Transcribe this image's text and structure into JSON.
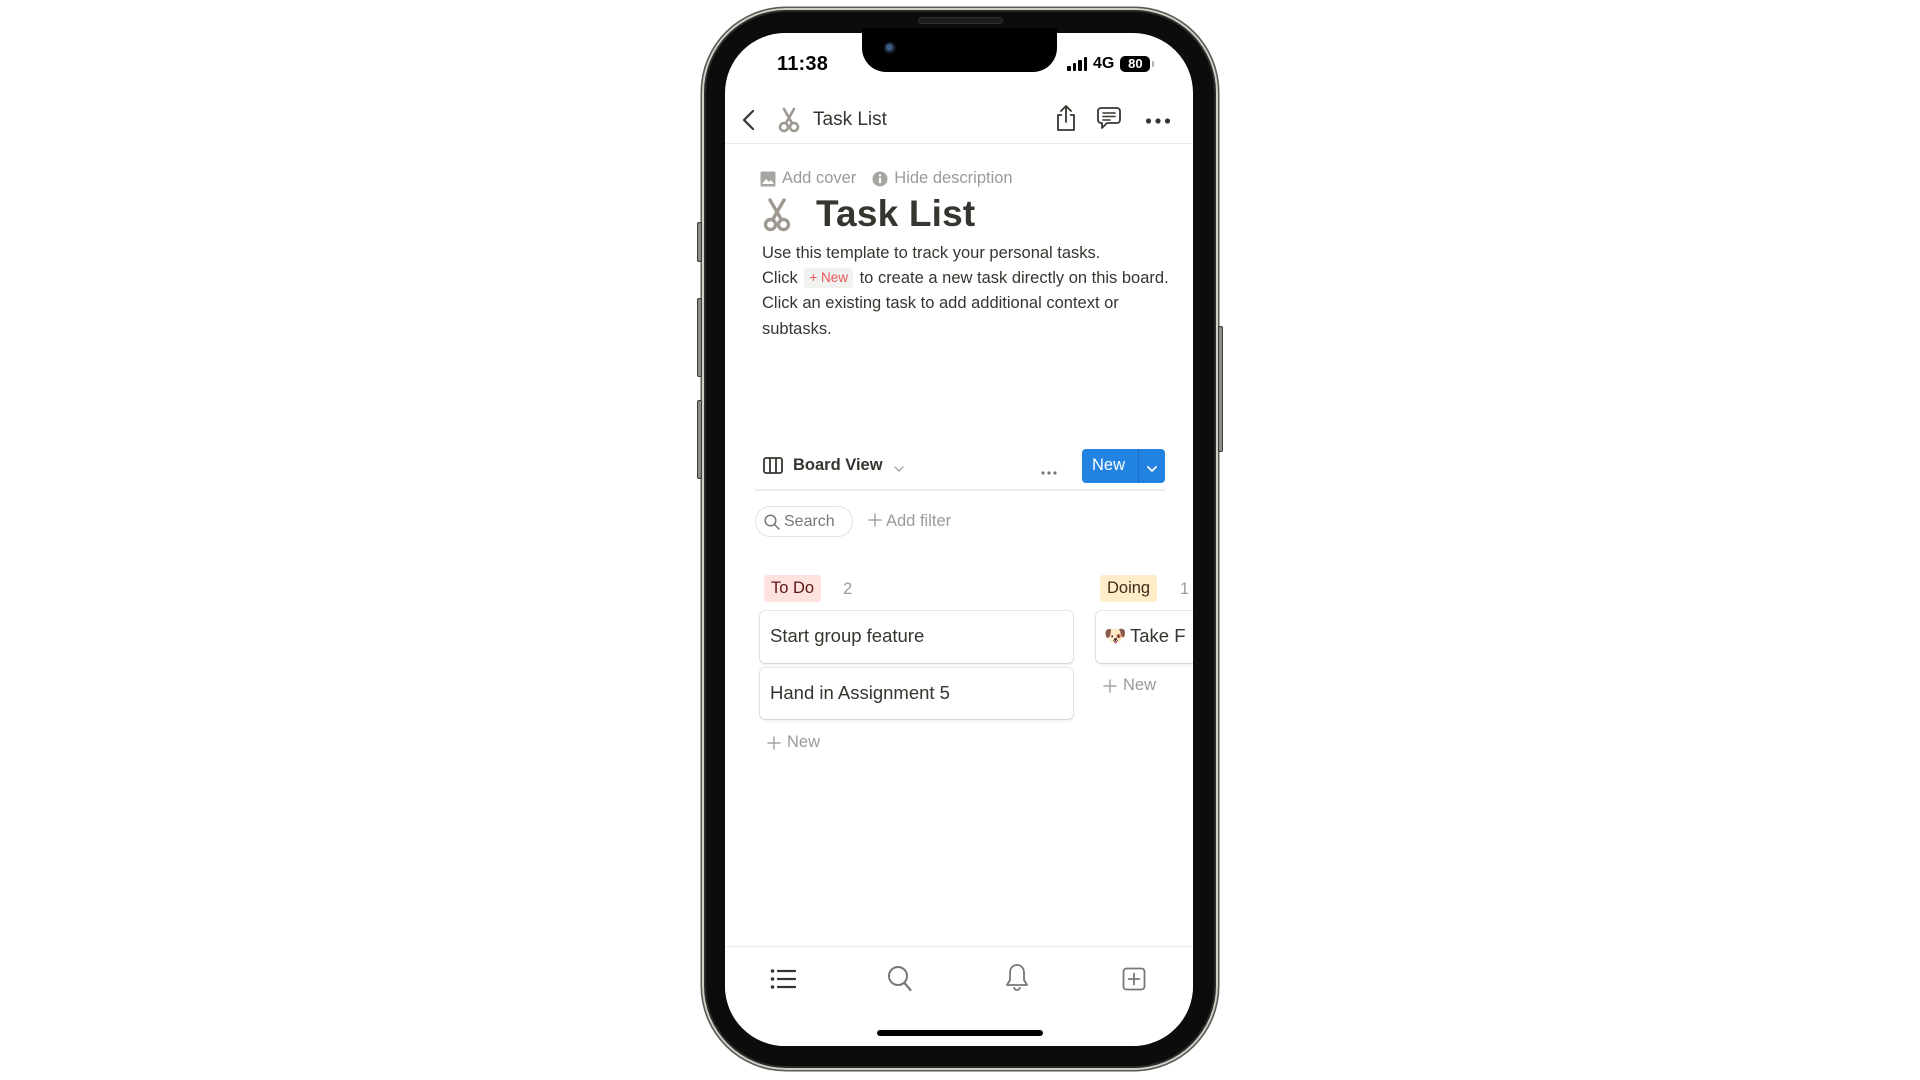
{
  "status_bar": {
    "time": "11:38",
    "network": "4G",
    "battery": "80"
  },
  "nav": {
    "back_icon": "chevron-left-icon",
    "page_icon": "scissors-icon",
    "title": "Task List",
    "actions": [
      {
        "name": "share",
        "icon": "share-icon"
      },
      {
        "name": "comments",
        "icon": "comment-icon"
      },
      {
        "name": "more",
        "icon": "more-horizontal-icon"
      }
    ]
  },
  "page_meta": {
    "add_cover": "Add cover",
    "hide_description": "Hide description"
  },
  "page": {
    "icon": "scissors-icon",
    "title": "Task List",
    "description": {
      "line1": "Use this template to track your personal tasks.",
      "line2_prefix": "Click",
      "inline_chip": "+ New",
      "line2_suffix": "to create a new task directly on this board.",
      "line3": "Click an existing task to add additional context or subtasks."
    }
  },
  "database": {
    "view_name": "Board View",
    "view_icon": "board-columns-icon",
    "new_button": "New",
    "search_label": "Search",
    "add_filter": "+ Add filter",
    "add_filter_label": "Add filter"
  },
  "board": {
    "columns": [
      {
        "name": "To Do",
        "count": "2",
        "tag_bg": "#FDE2DD",
        "tag_fg": "#5D1715",
        "cards": [
          {
            "title": "Start group feature"
          },
          {
            "title": "Hand in Assignment 5"
          }
        ],
        "add_new": "New"
      },
      {
        "name": "Doing",
        "count": "1",
        "tag_bg": "#FDECC8",
        "tag_fg": "#402C1B",
        "cards": [
          {
            "title": "Take F",
            "icon": "dog-face-icon",
            "emoji": "🐶"
          }
        ],
        "add_new": "New"
      }
    ]
  },
  "tab_bar": {
    "items": [
      {
        "name": "home",
        "icon": "list-icon"
      },
      {
        "name": "search",
        "icon": "search-icon"
      },
      {
        "name": "updates",
        "icon": "bell-icon"
      },
      {
        "name": "new-page",
        "icon": "add-page-icon"
      }
    ]
  },
  "colors": {
    "accent": "#2383E2",
    "text": "#37352F",
    "muted": "#9B9A97",
    "chip_text": "#EB5757"
  }
}
